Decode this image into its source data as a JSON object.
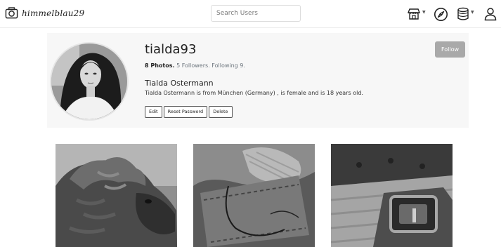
{
  "navbar": {
    "brand": "himmelblau29",
    "search_placeholder": "Search Users",
    "icons": [
      "shop-icon",
      "explore-compass-icon",
      "database-icon",
      "user-icon"
    ]
  },
  "profile": {
    "username": "tialda93",
    "stats": {
      "photos": "8 Photos.",
      "followers": "5 Followers.",
      "following": "Following 9."
    },
    "full_name": "Tialda Ostermann",
    "bio": "Tialda Ostermann is from München (Germany) , is female and is 18 years old.",
    "buttons": {
      "edit": "Edit",
      "reset_password": "Reset Password",
      "delete": "Delete"
    },
    "follow_label": "Follow"
  },
  "photos": [
    {
      "subject": "alpaca"
    },
    {
      "subject": "leather-stitching"
    },
    {
      "subject": "buckle"
    }
  ],
  "colors": {
    "follow_button": "#a9a9a9",
    "profile_background": "#f7f7f7",
    "muted_text": "#6c757d"
  }
}
